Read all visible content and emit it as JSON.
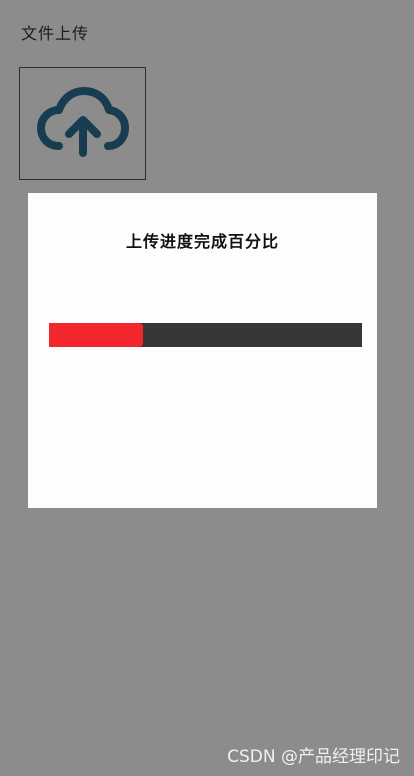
{
  "page": {
    "title": "文件上传",
    "upload_icon": "cloud-upload-icon",
    "upload_icon_color": "#2f6f93"
  },
  "dialog": {
    "title": "上传进度完成百分比",
    "progress": {
      "percent": 30,
      "fill_color": "#f2272b",
      "track_color": "#373737"
    }
  },
  "watermark": "CSDN @产品经理印记"
}
